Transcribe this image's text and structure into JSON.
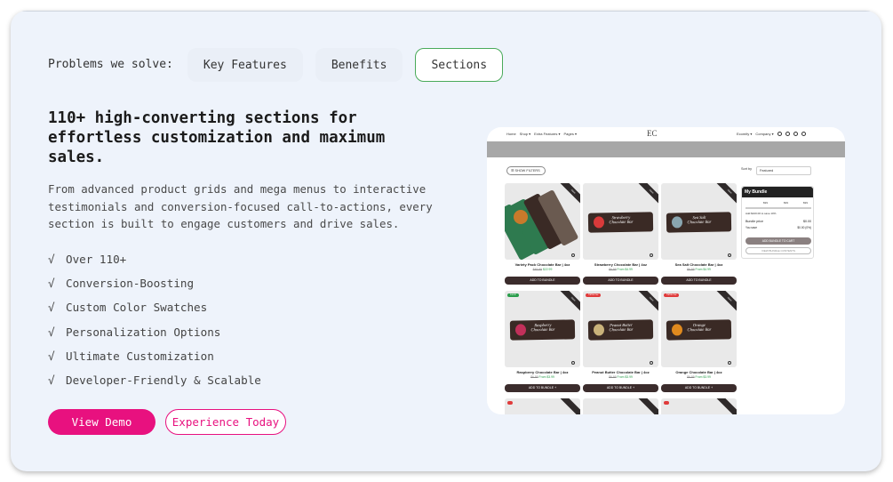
{
  "tabs": {
    "lead": "Problems we solve:",
    "items": [
      {
        "label": "Key Features"
      },
      {
        "label": "Benefits"
      },
      {
        "label": "Sections"
      }
    ],
    "active": "Sections"
  },
  "headline": "110+ high-converting sections for effortless customization and maximum sales.",
  "description": "From advanced product grids and mega menus to interactive testimonials and conversion-focused call-to-actions, every section is built to engage customers and drive sales.",
  "features": [
    "Over 110+",
    "Conversion-Boosting",
    "Custom Color Swatches",
    "Personalization Options",
    "Ultimate Customization",
    "Developer-Friendly & Scalable"
  ],
  "check_glyph": "√",
  "buttons": {
    "primary": "View Demo",
    "secondary": "Experience Today"
  },
  "colors": {
    "accent": "#e8117f",
    "active_tab_border": "#4aaa5a",
    "card_bg": "#eef3fb"
  },
  "preview": {
    "nav_left": [
      "Home",
      "Shop ▾",
      "Extra Features ▾",
      "Pages ▾"
    ],
    "logo": "EC",
    "nav_right": [
      "Ecomify ▾",
      "Company ▾"
    ],
    "filter_label": "☰ SHOW FILTERS",
    "sort_label": "Sort by",
    "sort_value": "Featured",
    "add_label": "ADD TO BUNDLE",
    "add_label_plus": "ADD TO BUNDLE +",
    "products": [
      {
        "title": "Variety Pack Chocolate Bar | 4oz",
        "old": "$49.99",
        "price": "$22.99",
        "ribbon": "Save",
        "tag": "",
        "bar": "#2e7a4f",
        "fruit": "#c97a2b",
        "label": ""
      },
      {
        "title": "Strawberry Chocolate Bar | 4oz",
        "old": "$6.99",
        "price": "From $4.99",
        "ribbon": "Save",
        "tag": "",
        "bar": "#3a2a25",
        "fruit": "#d93a3a",
        "label": "Strawberry Chocolate Bar"
      },
      {
        "title": "Sea Salt Chocolate Bar | 4oz",
        "old": "$6.99",
        "price": "From $4.99",
        "ribbon": "Save",
        "tag": "",
        "bar": "#3a2a25",
        "fruit": "#8aa6b0",
        "label": "Sea Salt Chocolate Bar"
      },
      {
        "title": "Raspberry Chocolate Bar | 4oz",
        "old": "$6.99",
        "price": "From $3.99",
        "ribbon": "Save",
        "tag": "Just in",
        "bar": "#3a2a25",
        "fruit": "#c2305a",
        "label": "Raspberry Chocolate Bar"
      },
      {
        "title": "Peanut Butter Chocolate Bar | 4oz",
        "old": "$6.99",
        "price": "From $3.99",
        "ribbon": "Save",
        "tag": "TikTok Fav",
        "bar": "#3a2a25",
        "fruit": "#c9b27a",
        "label": "Peanut Butter Chocolate Bar"
      },
      {
        "title": "Orange Chocolate Bar | 4oz",
        "old": "$6.99",
        "price": "From $3.99",
        "ribbon": "Save",
        "tag": "TikTok Fav",
        "bar": "#3a2a25",
        "fruit": "#e08a1e",
        "label": "Orange Chocolate Bar"
      }
    ],
    "bundle": {
      "title": "My Bundle",
      "tiers": [
        "$99",
        "$99",
        "$99"
      ],
      "add_line": "Add $100.00 to save 10%",
      "price_label": "Bundle price",
      "price_value": "$0.00",
      "save_label": "You save",
      "save_value": "$0.00 (0%)",
      "cta": "ADD BUNDLE TO CART",
      "cta2": "VIEW BUNDLE CONTENTS"
    }
  }
}
